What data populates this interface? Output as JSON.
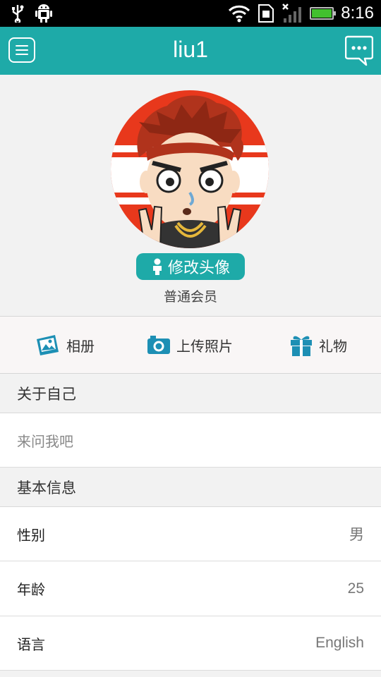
{
  "statusbar": {
    "time": "8:16"
  },
  "header": {
    "title": "liu1"
  },
  "profile": {
    "edit_avatar_label": "修改头像",
    "member_level": "普通会员"
  },
  "actions": [
    {
      "label": "相册",
      "icon": "album-icon"
    },
    {
      "label": "上传照片",
      "icon": "camera-icon"
    },
    {
      "label": "礼物",
      "icon": "gift-icon"
    }
  ],
  "about": {
    "heading": "关于自己",
    "text": "来问我吧"
  },
  "basic": {
    "heading": "基本信息",
    "rows": [
      {
        "label": "性别",
        "value": "男"
      },
      {
        "label": "年龄",
        "value": "25"
      },
      {
        "label": "语言",
        "value": "English"
      }
    ]
  },
  "colors": {
    "accent": "#1eaaa8",
    "background": "#f2f2f2"
  }
}
